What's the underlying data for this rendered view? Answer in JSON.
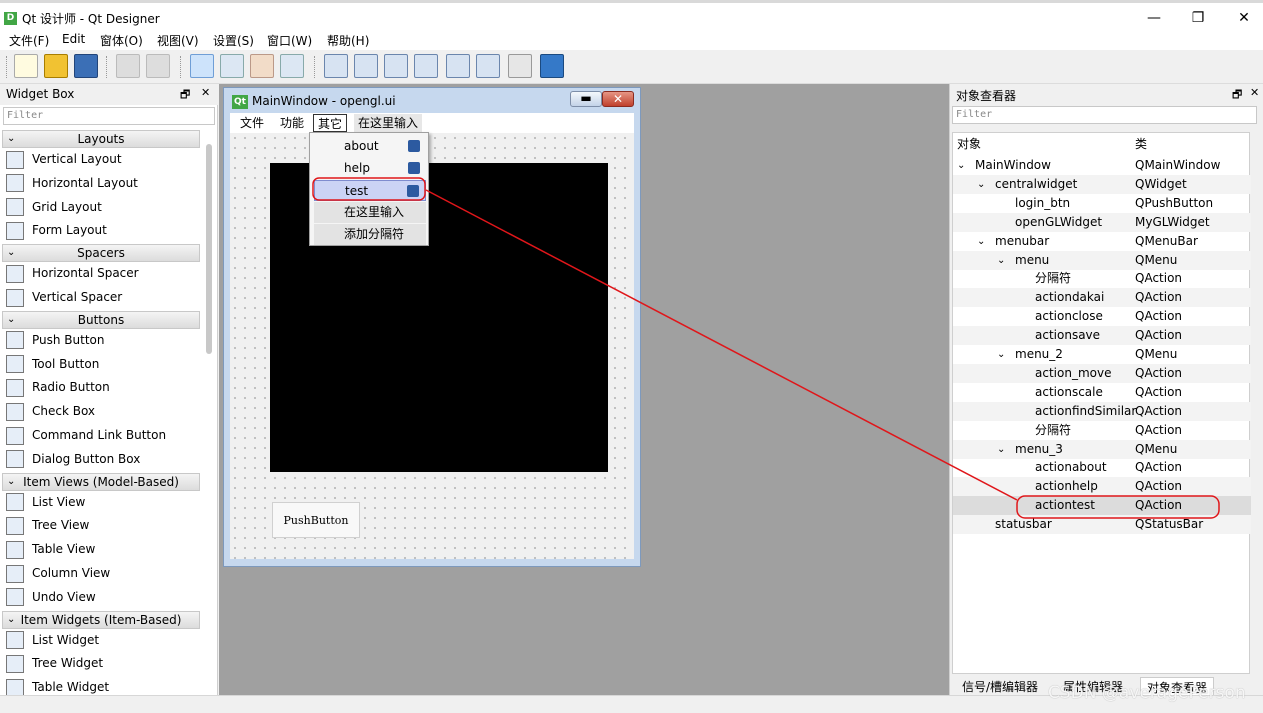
{
  "window": {
    "title": "Qt 设计师 - Qt Designer",
    "app_icon": "D",
    "min": "—",
    "max": "❐",
    "close": "✕"
  },
  "menubar": [
    "文件(F)",
    "Edit",
    "窗体(O)",
    "视图(V)",
    "设置(S)",
    "窗口(W)",
    "帮助(H)"
  ],
  "widget_box": {
    "title": "Widget Box",
    "filter_placeholder": "Filter",
    "head_icons": [
      "🗗",
      "✕"
    ],
    "categories": [
      {
        "label": "Layouts",
        "items": [
          "Vertical Layout",
          "Horizontal Layout",
          "Grid Layout",
          "Form Layout"
        ]
      },
      {
        "label": "Spacers",
        "items": [
          "Horizontal Spacer",
          "Vertical Spacer"
        ]
      },
      {
        "label": "Buttons",
        "items": [
          "Push Button",
          "Tool Button",
          "Radio Button",
          "Check Box",
          "Command Link Button",
          "Dialog Button Box"
        ]
      },
      {
        "label": "Item Views (Model-Based)",
        "items": [
          "List View",
          "Tree View",
          "Table View",
          "Column View",
          "Undo View"
        ]
      },
      {
        "label": "Item Widgets (Item-Based)",
        "items": [
          "List Widget",
          "Tree Widget",
          "Table Widget"
        ]
      }
    ]
  },
  "form": {
    "title": "MainWindow - opengl.ui",
    "qt_logo": "Qt",
    "menus": [
      "文件",
      "功能",
      "其它",
      "在这里输入"
    ],
    "push_button": "PushButton",
    "popup": [
      "about",
      "help",
      "test",
      "在这里输入",
      "添加分隔符"
    ]
  },
  "object_inspector": {
    "title": "对象查看器",
    "head_icons": [
      "🗗",
      "✕"
    ],
    "filter_placeholder": "Filter",
    "col_object": "对象",
    "col_class": "类",
    "rows": [
      {
        "name": "MainWindow",
        "cls": "QMainWindow",
        "depth": 0,
        "expand": true
      },
      {
        "name": "centralwidget",
        "cls": "QWidget",
        "depth": 1,
        "expand": true
      },
      {
        "name": "login_btn",
        "cls": "QPushButton",
        "depth": 2,
        "expand": false
      },
      {
        "name": "openGLWidget",
        "cls": "MyGLWidget",
        "depth": 2,
        "expand": false
      },
      {
        "name": "menubar",
        "cls": "QMenuBar",
        "depth": 1,
        "expand": true
      },
      {
        "name": "menu",
        "cls": "QMenu",
        "depth": 2,
        "expand": true
      },
      {
        "name": "分隔符",
        "cls": "QAction",
        "depth": 3,
        "expand": false
      },
      {
        "name": "actiondakai",
        "cls": "QAction",
        "depth": 3,
        "expand": false
      },
      {
        "name": "actionclose",
        "cls": "QAction",
        "depth": 3,
        "expand": false
      },
      {
        "name": "actionsave",
        "cls": "QAction",
        "depth": 3,
        "expand": false
      },
      {
        "name": "menu_2",
        "cls": "QMenu",
        "depth": 2,
        "expand": true
      },
      {
        "name": "action_move",
        "cls": "QAction",
        "depth": 3,
        "expand": false
      },
      {
        "name": "actionscale",
        "cls": "QAction",
        "depth": 3,
        "expand": false
      },
      {
        "name": "actionfindSimilar",
        "cls": "QAction",
        "depth": 3,
        "expand": false
      },
      {
        "name": "分隔符",
        "cls": "QAction",
        "depth": 3,
        "expand": false
      },
      {
        "name": "menu_3",
        "cls": "QMenu",
        "depth": 2,
        "expand": true
      },
      {
        "name": "actionabout",
        "cls": "QAction",
        "depth": 3,
        "expand": false
      },
      {
        "name": "actionhelp",
        "cls": "QAction",
        "depth": 3,
        "expand": false
      },
      {
        "name": "actiontest",
        "cls": "QAction",
        "depth": 3,
        "expand": false
      },
      {
        "name": "statusbar",
        "cls": "QStatusBar",
        "depth": 1,
        "expand": false
      }
    ],
    "tabs": [
      "信号/槽编辑器",
      "属性编辑器",
      "对象查看器"
    ]
  },
  "watermark": "CSDN @averagePerson",
  "annotation_color": "#e0161a"
}
